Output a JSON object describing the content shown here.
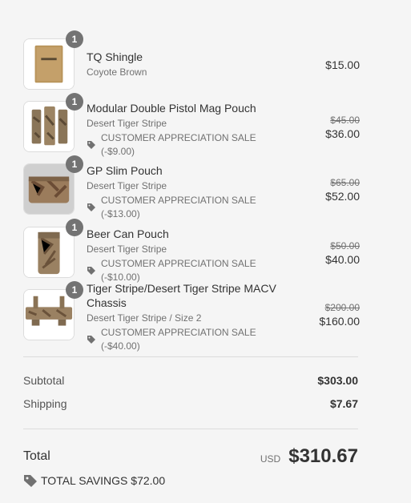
{
  "items": [
    {
      "qty": "1",
      "name": "TQ Shingle",
      "variant": "Coyote Brown",
      "discount": "",
      "old_price": "",
      "price": "$15.00",
      "thumb": "tq-shingle"
    },
    {
      "qty": "1",
      "name": "Modular Double Pistol Mag Pouch",
      "variant": "Desert Tiger Stripe",
      "discount": "CUSTOMER APPRECIATION SALE (-$9.00)",
      "old_price": "$45.00",
      "price": "$36.00",
      "thumb": "mag-pouch"
    },
    {
      "qty": "1",
      "name": "GP Slim Pouch",
      "variant": "Desert Tiger Stripe",
      "discount": "CUSTOMER APPRECIATION SALE (-$13.00)",
      "old_price": "$65.00",
      "price": "$52.00",
      "thumb": "gp-pouch"
    },
    {
      "qty": "1",
      "name": "Beer Can Pouch",
      "variant": "Desert Tiger Stripe",
      "discount": "CUSTOMER APPRECIATION SALE (-$10.00)",
      "old_price": "$50.00",
      "price": "$40.00",
      "thumb": "can-pouch"
    },
    {
      "qty": "1",
      "name": "Tiger Stripe/Desert Tiger Stripe MACV Chassis",
      "variant": "Desert Tiger Stripe / Size 2",
      "discount": "CUSTOMER APPRECIATION SALE (-$40.00)",
      "old_price": "$200.00",
      "price": "$160.00",
      "thumb": "macv-chassis"
    }
  ],
  "subtotal": {
    "label": "Subtotal",
    "value": "$303.00"
  },
  "shipping": {
    "label": "Shipping",
    "value": "$7.67"
  },
  "total": {
    "label": "Total",
    "currency": "USD",
    "value": "$310.67"
  },
  "savings": {
    "text": "TOTAL SAVINGS $72.00"
  },
  "icons": {
    "discount": "tag-icon",
    "savings": "tag-icon"
  },
  "colors": {
    "background": "#f5f5f5",
    "badge": "#737373",
    "text": "#333333",
    "muted": "#717171"
  }
}
